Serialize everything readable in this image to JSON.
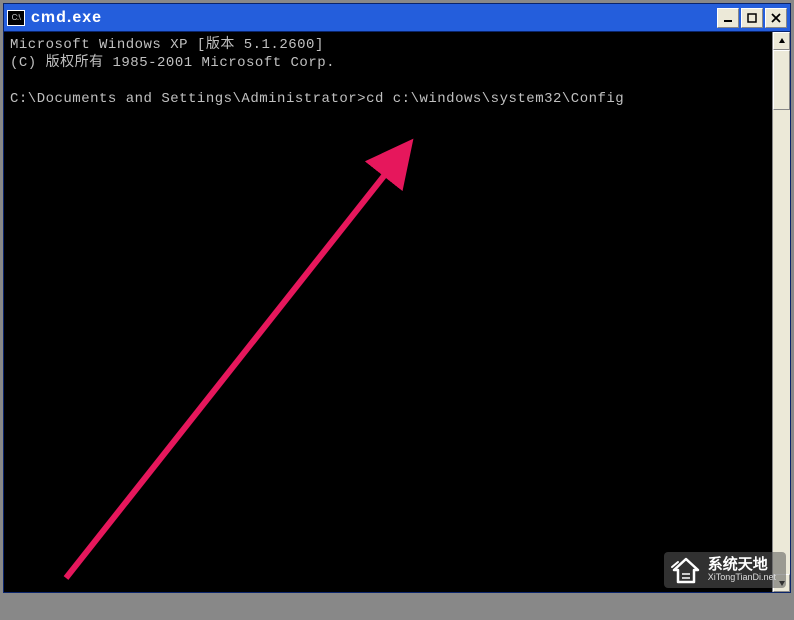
{
  "window": {
    "title": "cmd.exe",
    "icon_label": "C:\\"
  },
  "console": {
    "line1": "Microsoft Windows XP [版本 5.1.2600]",
    "line2": "(C) 版权所有 1985-2001 Microsoft Corp.",
    "blank": "",
    "prompt": "C:\\Documents and Settings\\Administrator>",
    "command": "cd c:\\windows\\system32\\Config"
  },
  "watermark": {
    "main": "系统天地",
    "sub": "XiTongTianDi.net"
  },
  "annotation": {
    "type": "arrow",
    "color": "#e6175c"
  }
}
